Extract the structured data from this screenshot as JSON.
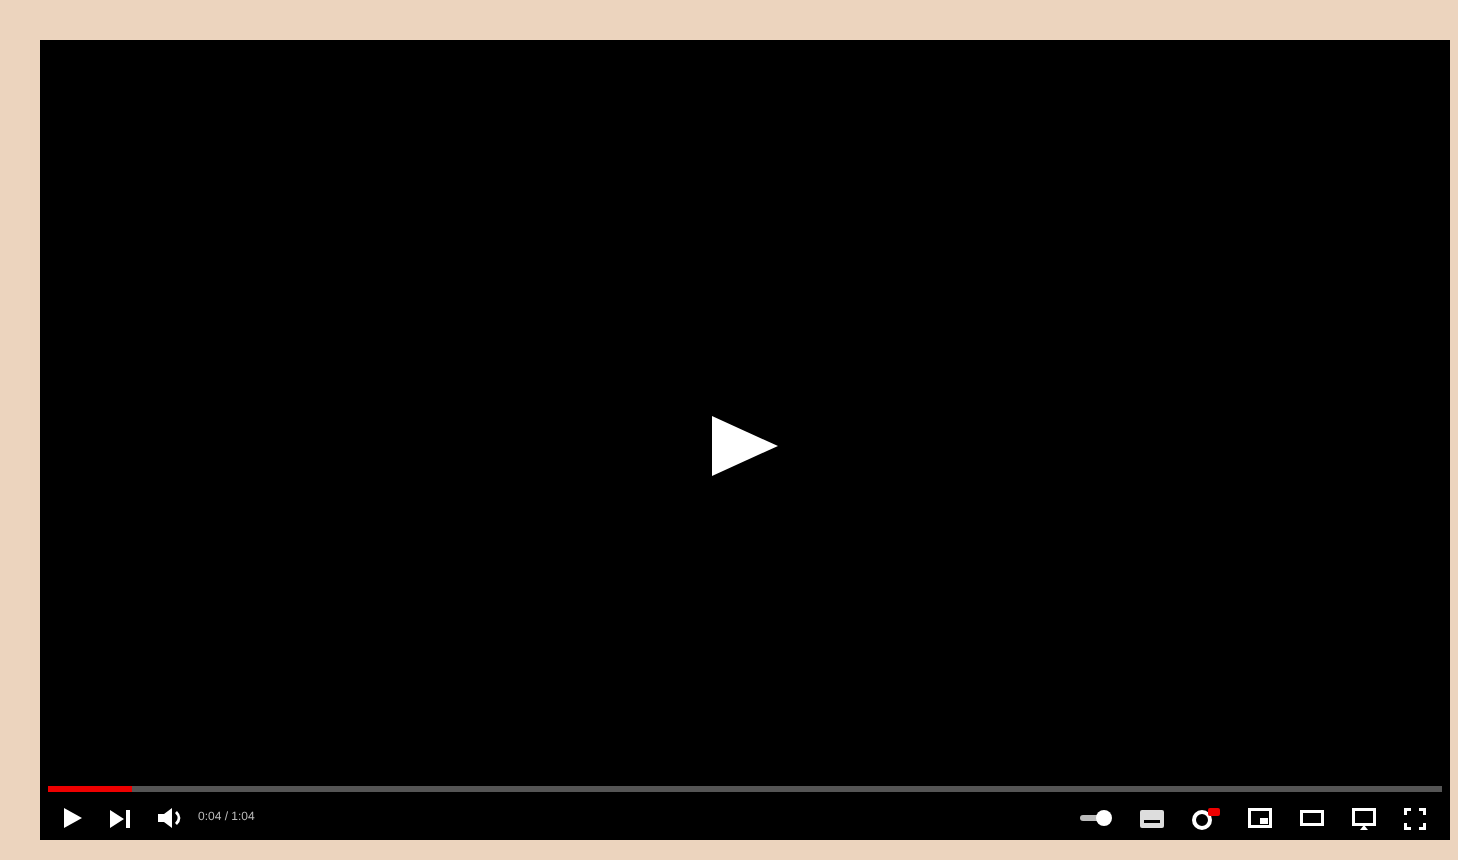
{
  "player": {
    "progress": {
      "level": 0.06
    },
    "time": "0:04 / 1:04",
    "settings": {
      "hd_badge": true
    }
  }
}
